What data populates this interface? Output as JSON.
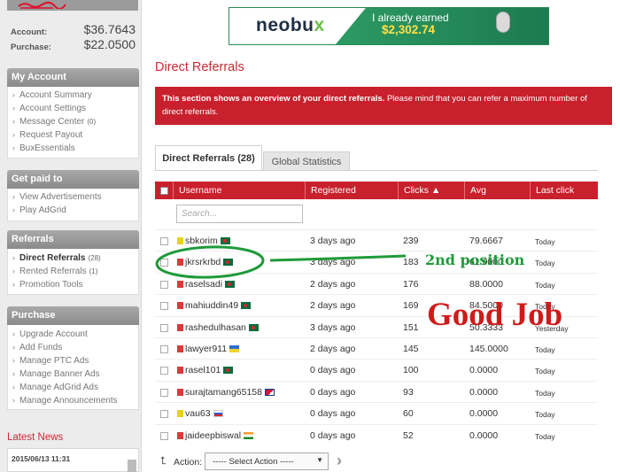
{
  "balance": {
    "account_label": "Account:",
    "account_value": "$36.7643",
    "purchase_label": "Purchase:",
    "purchase_value": "$22.0500"
  },
  "sidebar": {
    "my_account": {
      "title": "My Account",
      "items": [
        {
          "label": "Account Summary"
        },
        {
          "label": "Account Settings"
        },
        {
          "label": "Message Center",
          "count": "(0)"
        },
        {
          "label": "Request Payout"
        },
        {
          "label": "BuxEssentials"
        }
      ]
    },
    "get_paid": {
      "title": "Get paid to",
      "items": [
        {
          "label": "View Advertisements"
        },
        {
          "label": "Play AdGrid"
        }
      ]
    },
    "referrals": {
      "title": "Referrals",
      "items": [
        {
          "label": "Direct Referrals",
          "count": "(28)",
          "active": true
        },
        {
          "label": "Rented Referrals",
          "count": "(1)"
        },
        {
          "label": "Promotion Tools"
        }
      ]
    },
    "purchase": {
      "title": "Purchase",
      "items": [
        {
          "label": "Upgrade Account"
        },
        {
          "label": "Add Funds"
        },
        {
          "label": "Manage PTC Ads"
        },
        {
          "label": "Manage Banner Ads"
        },
        {
          "label": "Manage AdGrid Ads"
        },
        {
          "label": "Manage Announcements"
        }
      ]
    },
    "latest_news": {
      "title": "Latest News",
      "date": "2015/06/13 11:31"
    }
  },
  "banner": {
    "logo": "neobu",
    "logo_x": "x",
    "earned_text": "I already earned",
    "earned_amount": "$2,302.74"
  },
  "page": {
    "title": "Direct Referrals",
    "alert_bold": "This section shows an overview of your direct referrals.",
    "alert_rest": " Please mind that you can refer a maximum number of direct referrals."
  },
  "tabs": {
    "direct_label": "Direct Referrals",
    "direct_count": "(28)",
    "global_label": "Global Statistics"
  },
  "table": {
    "columns": {
      "username": "Username",
      "registered": "Registered",
      "clicks": "Clicks ▲",
      "avg": "Avg",
      "last_click": "Last click"
    },
    "search_placeholder": "Search...",
    "rows": [
      {
        "username": "sbkorim",
        "icon": "#e7d21e",
        "flag": "bd",
        "registered": "3 days ago",
        "clicks": "239",
        "avg": "79.6667",
        "last": "Today"
      },
      {
        "username": "jkrsrkrbd",
        "icon": "#d93a3a",
        "flag": "bd",
        "registered": "3 days ago",
        "clicks": "183",
        "avg": "61.0000",
        "last": "Today"
      },
      {
        "username": "raselsadi",
        "icon": "#d93a3a",
        "flag": "bd",
        "registered": "2 days ago",
        "clicks": "176",
        "avg": "88.0000",
        "last": "Today"
      },
      {
        "username": "mahiuddin49",
        "icon": "#d93a3a",
        "flag": "bd",
        "registered": "2 days ago",
        "clicks": "169",
        "avg": "84.5000",
        "last": "Today"
      },
      {
        "username": "rashedulhasan",
        "icon": "#d93a3a",
        "flag": "bd",
        "registered": "3 days ago",
        "clicks": "151",
        "avg": "50.3333",
        "last": "Yesterday"
      },
      {
        "username": "lawyer911",
        "icon": "#d93a3a",
        "flag": "ua",
        "registered": "2 days ago",
        "clicks": "145",
        "avg": "145.0000",
        "last": "Today"
      },
      {
        "username": "rasel101",
        "icon": "#d93a3a",
        "flag": "bd",
        "registered": "0 days ago",
        "clicks": "100",
        "avg": "0.0000",
        "last": "Today"
      },
      {
        "username": "surajtamang65158",
        "icon": "#d93a3a",
        "flag": "np",
        "registered": "0 days ago",
        "clicks": "93",
        "avg": "0.0000",
        "last": "Today"
      },
      {
        "username": "vau63",
        "icon": "#e7d21e",
        "flag": "ru",
        "registered": "0 days ago",
        "clicks": "60",
        "avg": "0.0000",
        "last": "Today"
      },
      {
        "username": "jaideepbiswal",
        "icon": "#d93a3a",
        "flag": "in",
        "registered": "0 days ago",
        "clicks": "52",
        "avg": "0.0000",
        "last": "Today"
      }
    ],
    "action_label": "Action:",
    "action_select": "----- Select Action -----"
  },
  "annotations": {
    "position_note": "2nd position",
    "good_note": "Good Job",
    "circle_color": "#1f9a3a"
  },
  "colors": {
    "brand_red": "#c8202c",
    "title_red": "#c92a34",
    "banner_green": "#2d9a63"
  }
}
